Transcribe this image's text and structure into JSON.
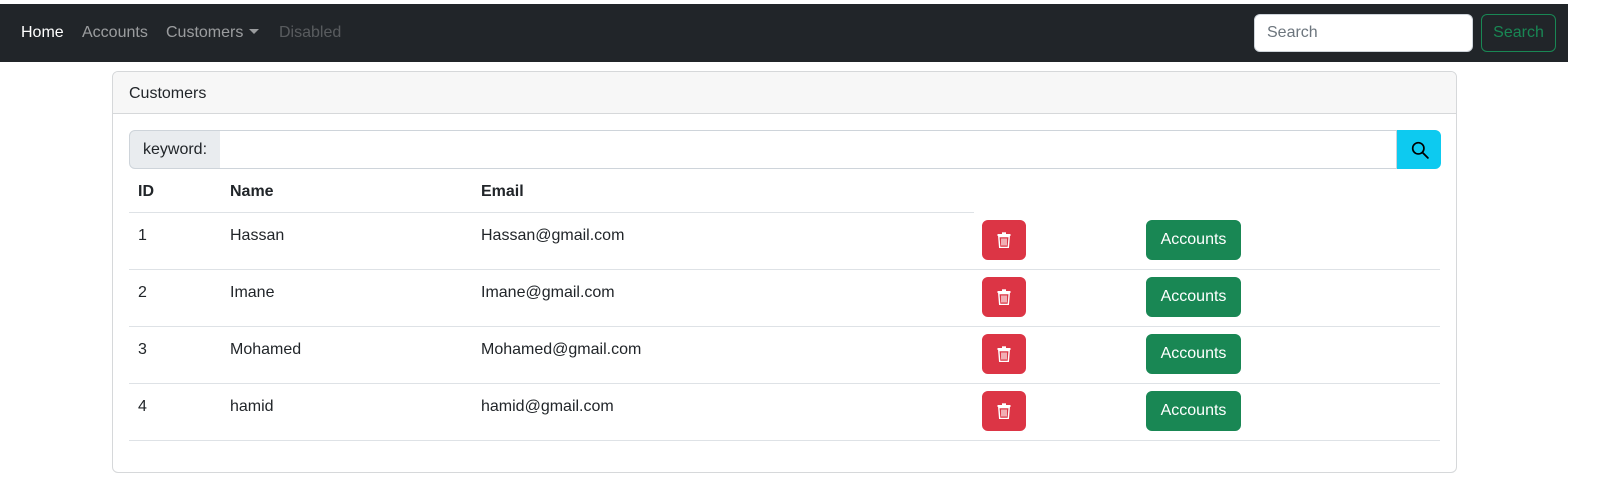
{
  "navbar": {
    "links": [
      {
        "label": "Home"
      },
      {
        "label": "Accounts"
      },
      {
        "label": "Customers"
      },
      {
        "label": "Disabled"
      }
    ],
    "search_placeholder": "Search",
    "search_button": "Search"
  },
  "card": {
    "title": "Customers",
    "keyword_label": "keyword:",
    "keyword_value": "",
    "search_icon": "search-icon"
  },
  "table": {
    "columns": [
      "ID",
      "Name",
      "Email"
    ],
    "rows": [
      {
        "id": "1",
        "name": "Hassan",
        "email": "Hassan@gmail.com",
        "action": "Accounts"
      },
      {
        "id": "2",
        "name": "Imane",
        "email": "Imane@gmail.com",
        "action": "Accounts"
      },
      {
        "id": "3",
        "name": "Mohamed",
        "email": "Mohamed@gmail.com",
        "action": "Accounts"
      },
      {
        "id": "4",
        "name": "hamid",
        "email": "hamid@gmail.com",
        "action": "Accounts"
      }
    ],
    "delete_icon": "trash-icon"
  },
  "colors": {
    "navbar_bg": "#212529",
    "danger": "#dc3545",
    "success": "#198754",
    "info": "#0dcaf0"
  }
}
